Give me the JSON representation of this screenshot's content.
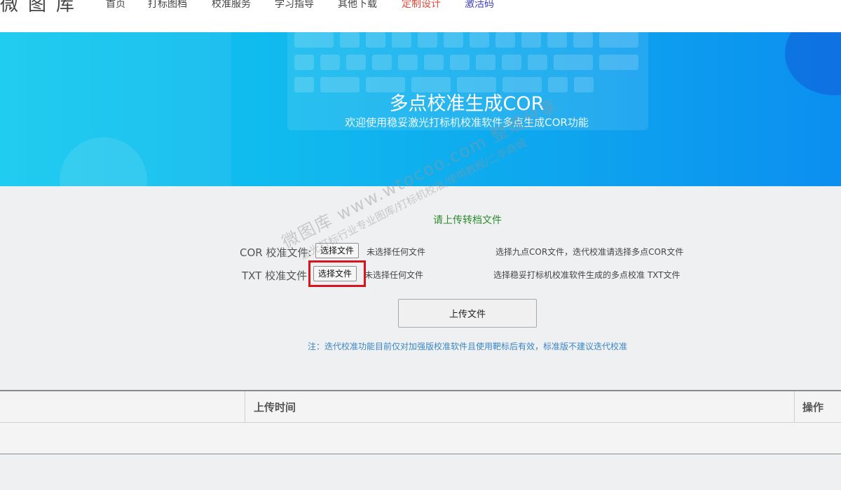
{
  "logo": {
    "text": "微图库"
  },
  "nav": {
    "items": [
      {
        "label": "首页"
      },
      {
        "label": "打标图档"
      },
      {
        "label": "校准服务"
      },
      {
        "label": "学习指导"
      },
      {
        "label": "其他下载"
      },
      {
        "label": "定制设计"
      },
      {
        "label": "激活码"
      }
    ]
  },
  "hero": {
    "title": "多点校准生成COR",
    "subtitle": "欢迎使用稳妥激光打标机校准软件多点生成COR功能"
  },
  "upload": {
    "heading": "请上传转档文件",
    "cor": {
      "label": "COR 校准文件:",
      "button": "选择文件",
      "status": "未选择任何文件",
      "hint": "选择九点COR文件，迭代校准请选择多点COR文件"
    },
    "txt": {
      "label": "TXT 校准文件",
      "button": "选择文件",
      "status": "未选择任何文件",
      "hint": "选择稳妥打标机校准软件生成的多点校准 TXT文件"
    },
    "submit": "上传文件",
    "note": "注：迭代校准功能目前仅对加强版校准软件且使用靶标后有效，标准版不建议迭代校准"
  },
  "watermark": {
    "line1": "微图库 www.wtocoo.com 整理分享",
    "line2": "激光打标行业专业图库/打标机校准/使用教程/二手商城"
  },
  "table": {
    "columns": [
      "",
      "上传时间",
      "操作"
    ]
  },
  "colors": {
    "accent_red": "#d8141c",
    "nav_red": "#e5493a",
    "nav_blue": "#3c3cc8",
    "heading_green": "#2e8b2e",
    "note_blue": "#3a86c8",
    "hero_start": "#13c9ee",
    "hero_end": "#0b8ff0"
  }
}
